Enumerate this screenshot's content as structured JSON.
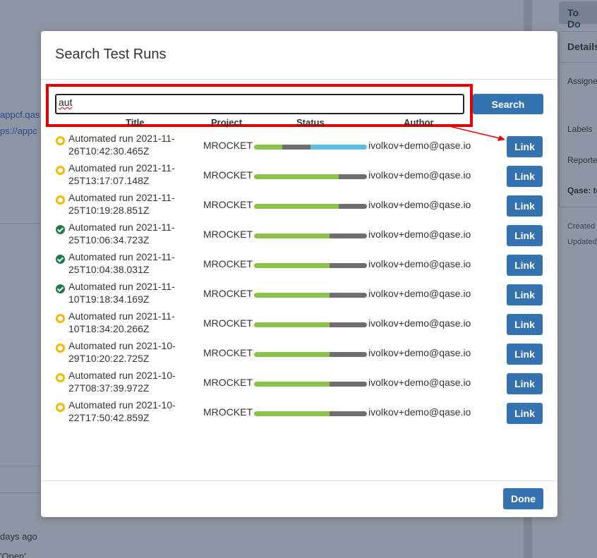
{
  "background": {
    "status_button": "To Do",
    "details_title": "Details",
    "right_labels": [
      "Assigne",
      "Labels",
      "Reporte",
      "Qase: te"
    ],
    "right_meta": [
      "Created",
      "Updated"
    ],
    "left_links": [
      "appcf.qas",
      "ps://appc"
    ],
    "left_text": [
      "days ago",
      "'Open'"
    ]
  },
  "modal": {
    "title": "Search Test Runs",
    "search": {
      "value": "aut",
      "button_label": "Search"
    },
    "columns": {
      "title": "Title",
      "project": "Project",
      "status": "Status",
      "author": "Author"
    },
    "rows": [
      {
        "status": "in-progress",
        "title": "Automated run 2021-11-26T10:42:30.465Z",
        "project": "MROCKET",
        "author": "ivolkov+demo@qase.io",
        "link_label": "Link",
        "bar": [
          {
            "color": "#8bc34a",
            "frac": 0.25
          },
          {
            "color": "#6e6e6e",
            "frac": 0.25
          },
          {
            "color": "#5bc0de",
            "frac": 0.5
          }
        ]
      },
      {
        "status": "in-progress",
        "title": "Automated run 2021-11-25T13:17:07.148Z",
        "project": "MROCKET",
        "author": "ivolkov+demo@qase.io",
        "link_label": "Link",
        "bar": [
          {
            "color": "#8bc34a",
            "frac": 0.75
          },
          {
            "color": "#6e6e6e",
            "frac": 0.25
          }
        ]
      },
      {
        "status": "in-progress",
        "title": "Automated run 2021-11-25T10:19:28.851Z",
        "project": "MROCKET",
        "author": "ivolkov+demo@qase.io",
        "link_label": "Link",
        "bar": [
          {
            "color": "#8bc34a",
            "frac": 0.75
          },
          {
            "color": "#6e6e6e",
            "frac": 0.25
          }
        ]
      },
      {
        "status": "passed",
        "title": "Automated run 2021-11-25T10:06:34.723Z",
        "project": "MROCKET",
        "author": "ivolkov+demo@qase.io",
        "link_label": "Link",
        "bar": [
          {
            "color": "#8bc34a",
            "frac": 0.67
          },
          {
            "color": "#6e6e6e",
            "frac": 0.33
          }
        ]
      },
      {
        "status": "passed",
        "title": "Automated run 2021-11-25T10:04:38.031Z",
        "project": "MROCKET",
        "author": "ivolkov+demo@qase.io",
        "link_label": "Link",
        "bar": [
          {
            "color": "#8bc34a",
            "frac": 0.67
          },
          {
            "color": "#6e6e6e",
            "frac": 0.33
          }
        ]
      },
      {
        "status": "passed",
        "title": "Automated run 2021-11-10T19:18:34.169Z",
        "project": "MROCKET",
        "author": "ivolkov+demo@qase.io",
        "link_label": "Link",
        "bar": [
          {
            "color": "#8bc34a",
            "frac": 0.67
          },
          {
            "color": "#6e6e6e",
            "frac": 0.33
          }
        ]
      },
      {
        "status": "in-progress",
        "title": "Automated run 2021-11-10T18:34:20.266Z",
        "project": "MROCKET",
        "author": "ivolkov+demo@qase.io",
        "link_label": "Link",
        "bar": [
          {
            "color": "#8bc34a",
            "frac": 0.67
          },
          {
            "color": "#6e6e6e",
            "frac": 0.33
          }
        ]
      },
      {
        "status": "in-progress",
        "title": "Automated run 2021-10-29T10:20:22.725Z",
        "project": "MROCKET",
        "author": "ivolkov+demo@qase.io",
        "link_label": "Link",
        "bar": [
          {
            "color": "#8bc34a",
            "frac": 0.67
          },
          {
            "color": "#6e6e6e",
            "frac": 0.33
          }
        ]
      },
      {
        "status": "in-progress",
        "title": "Automated run 2021-10-27T08:37:39.972Z",
        "project": "MROCKET",
        "author": "ivolkov+demo@qase.io",
        "link_label": "Link",
        "bar": [
          {
            "color": "#8bc34a",
            "frac": 0.67
          },
          {
            "color": "#6e6e6e",
            "frac": 0.33
          }
        ]
      },
      {
        "status": "in-progress",
        "title": "Automated run 2021-10-22T17:50:42.859Z",
        "project": "MROCKET",
        "author": "ivolkov+demo@qase.io",
        "link_label": "Link",
        "bar": [
          {
            "color": "#8bc34a",
            "frac": 0.67
          },
          {
            "color": "#6e6e6e",
            "frac": 0.33
          }
        ]
      }
    ],
    "done_label": "Done"
  },
  "colors": {
    "primary_button": "#3572b0",
    "highlight": "#e00000",
    "in_progress": "#f5b800",
    "passed": "#1e7a4b"
  }
}
